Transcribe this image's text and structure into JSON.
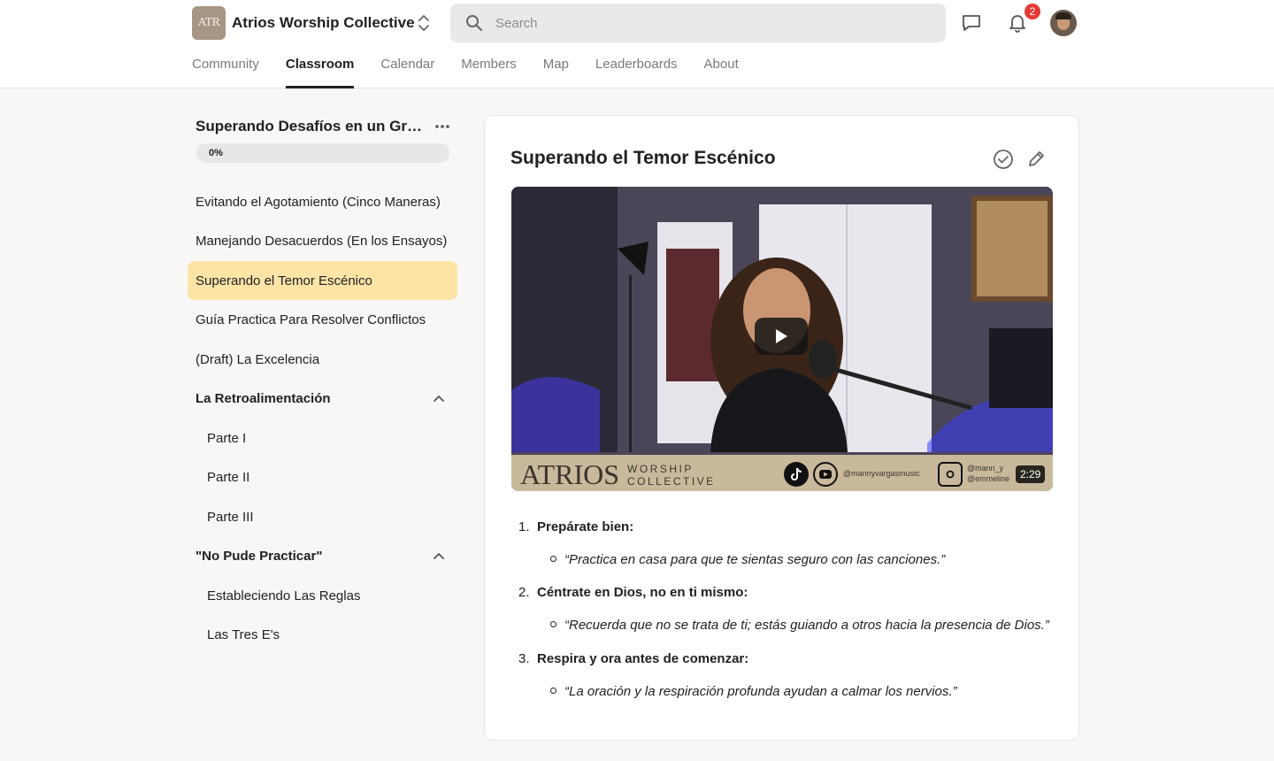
{
  "header": {
    "logo_text": "ATR",
    "group_name": "Atrios Worship Collective",
    "search_placeholder": "Search",
    "notification_count": "2",
    "tabs": [
      {
        "label": "Community"
      },
      {
        "label": "Classroom"
      },
      {
        "label": "Calendar"
      },
      {
        "label": "Members"
      },
      {
        "label": "Map"
      },
      {
        "label": "Leaderboards"
      },
      {
        "label": "About"
      }
    ],
    "active_tab": "Classroom"
  },
  "sidebar": {
    "course_title": "Superando Desafíos en un Grupo de Alabanza",
    "progress": {
      "value": 0,
      "label": "0%"
    },
    "lessons": [
      {
        "label": "Evitando el Agotamiento (Cinco Maneras)"
      },
      {
        "label": "Manejando Desacuerdos (En los Ensayos)"
      },
      {
        "label": "Superando el Temor Escénico"
      },
      {
        "label": "Guía Practica Para Resolver Conflictos"
      },
      {
        "label": "(Draft) La Excelencia"
      },
      {
        "label": "La Retroalimentación"
      },
      {
        "label": "Parte I"
      },
      {
        "label": "Parte II"
      },
      {
        "label": "Parte III"
      },
      {
        "label": "\"No Pude Practicar\""
      },
      {
        "label": "Estableciendo Las Reglas"
      },
      {
        "label": "Las Tres E's"
      }
    ]
  },
  "main": {
    "lesson_title": "Superando el Temor Escénico",
    "video": {
      "brand_main": "ATRIOS",
      "brand_sub": "WORSHIP COLLECTIVE",
      "handle_1": "@mannyvargasmusic",
      "handle_2": "@mann_y",
      "handle_3": "@emmeline",
      "duration": "2:29"
    },
    "points": [
      {
        "num": "1.",
        "head": "Prepárate bien:",
        "quote": "“Practica en casa para que te sientas seguro con las canciones.”"
      },
      {
        "num": "2.",
        "head": "Céntrate en Dios, no en ti mismo:",
        "quote": "“Recuerda que no se trata de ti; estás guiando a otros hacia la presencia de Dios.”"
      },
      {
        "num": "3.",
        "head": "Respira y ora antes de comenzar:",
        "quote": "“La oración y la respiración profunda ayudan a calmar los nervios.”"
      }
    ]
  }
}
